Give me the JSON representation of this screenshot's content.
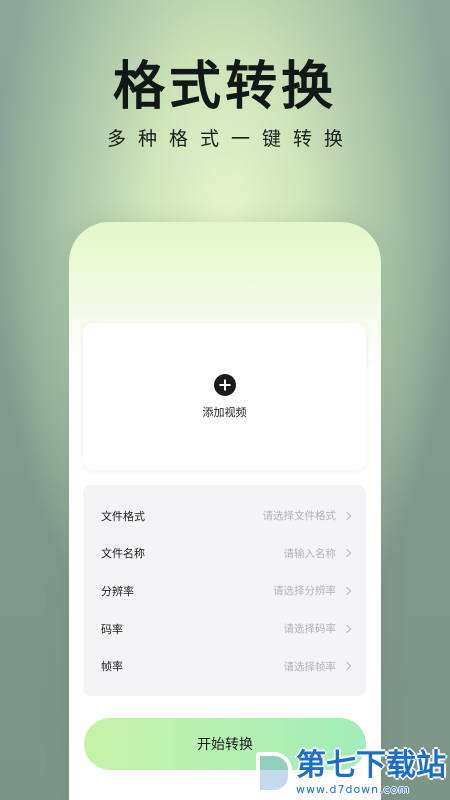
{
  "header": {
    "title": "格式转换",
    "subtitle": "多种格式一键转换"
  },
  "upload": {
    "icon": "add-circle-icon",
    "label": "添加视频"
  },
  "settings": {
    "rows": [
      {
        "label": "文件格式",
        "placeholder": "请选择文件格式"
      },
      {
        "label": "文件名称",
        "placeholder": "请输入名称"
      },
      {
        "label": "分辨率",
        "placeholder": "请选择分辨率"
      },
      {
        "label": "码率",
        "placeholder": "请选择码率"
      },
      {
        "label": "帧率",
        "placeholder": "请选择帧率"
      }
    ]
  },
  "action": {
    "start_label": "开始转换"
  },
  "watermark": {
    "title": "第七下载站",
    "url": "www.d7down.com"
  },
  "colors": {
    "button_start": "#c7f3a9",
    "button_end": "#a2edb9",
    "watermark": "#1d6ec9"
  }
}
